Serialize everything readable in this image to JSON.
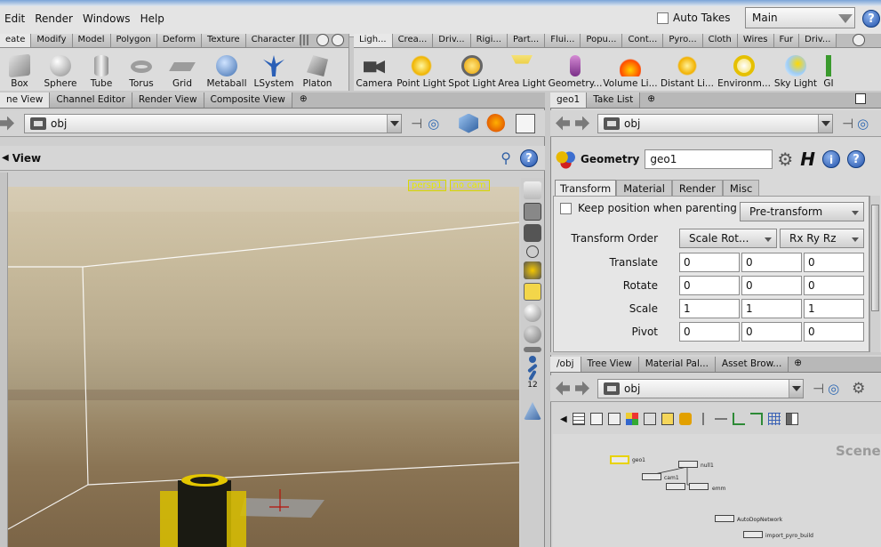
{
  "menubar": {
    "menus": [
      "Edit",
      "Render",
      "Windows",
      "Help"
    ],
    "auto_takes_label": "Auto Takes",
    "take_value": "Main"
  },
  "shelf_left": {
    "tabs": [
      "eate",
      "Modify",
      "Model",
      "Polygon",
      "Deform",
      "Texture",
      "Character"
    ],
    "tools": [
      "Box",
      "Sphere",
      "Tube",
      "Torus",
      "Grid",
      "Metaball",
      "LSystem",
      "Platon"
    ]
  },
  "shelf_right": {
    "tabs": [
      "Ligh...",
      "Crea...",
      "Driv...",
      "Rigi...",
      "Part...",
      "Flui...",
      "Popu...",
      "Cont...",
      "Pyro...",
      "Cloth",
      "Wires",
      "Fur",
      "Driv..."
    ],
    "tools": [
      "Camera",
      "Point Light",
      "Spot Light",
      "Area Light",
      "Geometry...",
      "Volume Li...",
      "Distant Li...",
      "Environm...",
      "Sky Light",
      "GI"
    ]
  },
  "left_pane": {
    "tabs": [
      "ne View",
      "Channel Editor",
      "Render View",
      "Composite View"
    ],
    "path": "obj",
    "view_title": "View",
    "cam_persp": "persp1",
    "cam_nocam": "no cam"
  },
  "param_pane": {
    "tabs": [
      "geo1",
      "Take List"
    ],
    "path": "obj",
    "node_type": "Geometry",
    "node_name": "geo1",
    "subtabs": [
      "Transform",
      "Material",
      "Render",
      "Misc"
    ],
    "keep_position_label": "Keep position when parenting",
    "keep_position_mode": "Pre-transform",
    "transform_order_label": "Transform Order",
    "transform_order_value": "Scale Rot...",
    "rotate_order_value": "Rx Ry Rz",
    "translate_label": "Translate",
    "translate": [
      "0",
      "0",
      "0"
    ],
    "rotate_label": "Rotate",
    "rotate": [
      "0",
      "0",
      "0"
    ],
    "scale_label": "Scale",
    "scale": [
      "1",
      "1",
      "1"
    ],
    "pivot_label": "Pivot",
    "pivot": [
      "0",
      "0",
      "0"
    ]
  },
  "network_pane": {
    "tabs": [
      "/obj",
      "Tree View",
      "Material Pal...",
      "Asset Brow..."
    ],
    "path": "obj",
    "scene_label": "Scene",
    "nodes": [
      "geo1",
      "null1",
      "cam1",
      "emm",
      "AutoDopNetwork",
      "import_pyro_build"
    ]
  }
}
